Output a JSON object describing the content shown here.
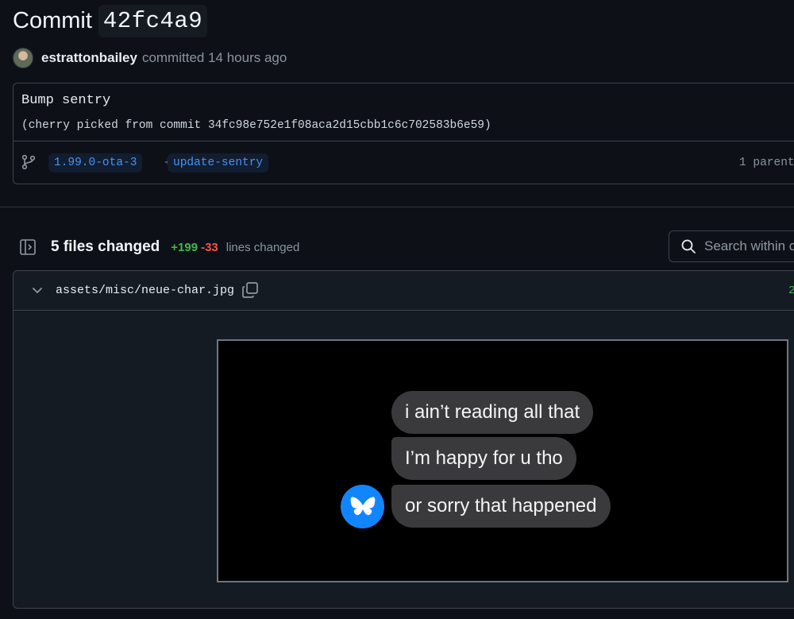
{
  "commit": {
    "title_prefix": "Commit",
    "sha_short": "42fc4a9",
    "author": "estrattonbailey",
    "committed_text": "committed 14 hours ago",
    "message_title": "Bump sentry",
    "message_body": "(cherry picked from commit 34fc98e752e1f08aca2d15cbb1c6c702583b6e59)",
    "branches": [
      "1.99.0-ota-3",
      "update-sentry"
    ],
    "branch_separator": "+",
    "parent_text": "1 parent"
  },
  "files_summary": {
    "files_changed": "5 files changed",
    "additions": "+199",
    "deletions": "-33",
    "lines_changed": "lines changed"
  },
  "search": {
    "placeholder": "Search within c"
  },
  "file": {
    "path": "assets/misc/neue-char.jpg",
    "stat": "2"
  },
  "image_preview": {
    "bubbles": [
      "i ain’t reading all that",
      "I’m happy for u tho",
      "or sorry that happened"
    ],
    "avatar_icon": "butterfly-icon"
  },
  "colors": {
    "background": "#0d1117",
    "link": "#4493f8",
    "additions": "#3fb950",
    "deletions": "#f85149",
    "bluesky_blue": "#1185fe"
  },
  "icons": [
    "branch-icon",
    "sidebar-toggle-icon",
    "search-icon",
    "chevron-down-icon",
    "copy-icon",
    "butterfly-icon"
  ]
}
